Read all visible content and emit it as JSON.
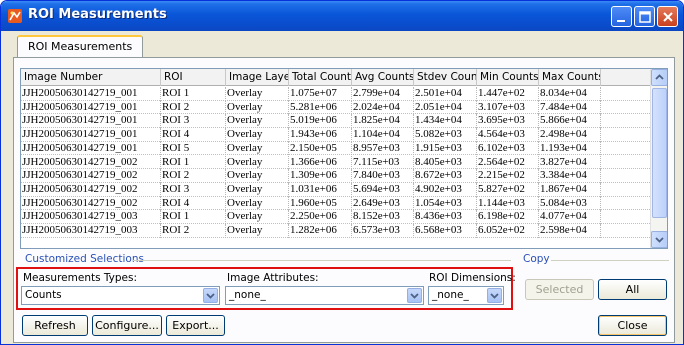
{
  "window": {
    "title": "ROI Measurements"
  },
  "tabs": [
    {
      "label": "ROI Measurements"
    }
  ],
  "table": {
    "columns": [
      "Image Number",
      "ROI",
      "Image Layer",
      "Total Counts",
      "Avg Counts",
      "Stdev Counts",
      "Min Counts",
      "Max Counts"
    ],
    "column_display": [
      "Image Number",
      "ROI",
      "Image Layei",
      "Total Counts",
      "Avg Counts",
      "Stdev Count",
      "Min Counts",
      "Max Counts"
    ],
    "rows": [
      [
        "JJH20050630142719_001",
        "ROI 1",
        "Overlay",
        "1.075e+07",
        "2.799e+04",
        "2.501e+04",
        "1.447e+02",
        "8.034e+04"
      ],
      [
        "JJH20050630142719_001",
        "ROI 2",
        "Overlay",
        "5.281e+06",
        "2.024e+04",
        "2.051e+04",
        "3.107e+03",
        "7.484e+04"
      ],
      [
        "JJH20050630142719_001",
        "ROI 3",
        "Overlay",
        "5.019e+06",
        "1.825e+04",
        "1.434e+04",
        "3.695e+03",
        "5.866e+04"
      ],
      [
        "JJH20050630142719_001",
        "ROI 4",
        "Overlay",
        "1.943e+06",
        "1.104e+04",
        "5.082e+03",
        "4.564e+03",
        "2.498e+04"
      ],
      [
        "JJH20050630142719_001",
        "ROI 5",
        "Overlay",
        "2.150e+05",
        "8.957e+03",
        "1.915e+03",
        "6.102e+03",
        "1.193e+04"
      ],
      [
        "JJH20050630142719_002",
        "ROI 1",
        "Overlay",
        "1.366e+06",
        "7.115e+03",
        "8.405e+03",
        "2.564e+02",
        "3.827e+04"
      ],
      [
        "JJH20050630142719_002",
        "ROI 2",
        "Overlay",
        "1.309e+06",
        "7.840e+03",
        "8.672e+03",
        "2.215e+02",
        "3.384e+04"
      ],
      [
        "JJH20050630142719_002",
        "ROI 3",
        "Overlay",
        "1.031e+06",
        "5.694e+03",
        "4.902e+03",
        "5.827e+02",
        "1.867e+04"
      ],
      [
        "JJH20050630142719_002",
        "ROI 4",
        "Overlay",
        "1.960e+05",
        "2.649e+03",
        "1.054e+03",
        "1.144e+03",
        "5.084e+03"
      ],
      [
        "JJH20050630142719_003",
        "ROI 1",
        "Overlay",
        "2.250e+06",
        "8.152e+03",
        "8.436e+03",
        "6.198e+02",
        "4.077e+04"
      ],
      [
        "JJH20050630142719_003",
        "ROI 2",
        "Overlay",
        "1.282e+06",
        "6.573e+03",
        "6.568e+03",
        "6.052e+02",
        "2.598e+04"
      ]
    ]
  },
  "customized_selections": {
    "title": "Customized Selections",
    "measurements_types": {
      "label": "Measurements Types:",
      "value": "Counts"
    },
    "image_attributes": {
      "label": "Image Attributes:",
      "value": "_none_"
    },
    "roi_dimensions": {
      "label": "ROI Dimensions:",
      "value": "_none_"
    }
  },
  "copy": {
    "title": "Copy",
    "selected_label": "Selected",
    "all_label": "All"
  },
  "buttons": {
    "refresh": "Refresh",
    "configure": "Configure...",
    "export": "Export...",
    "close": "Close"
  },
  "colors": {
    "titlebar": "#0a56d8",
    "highlight_box": "#e01010",
    "group_title": "#2950b5"
  }
}
